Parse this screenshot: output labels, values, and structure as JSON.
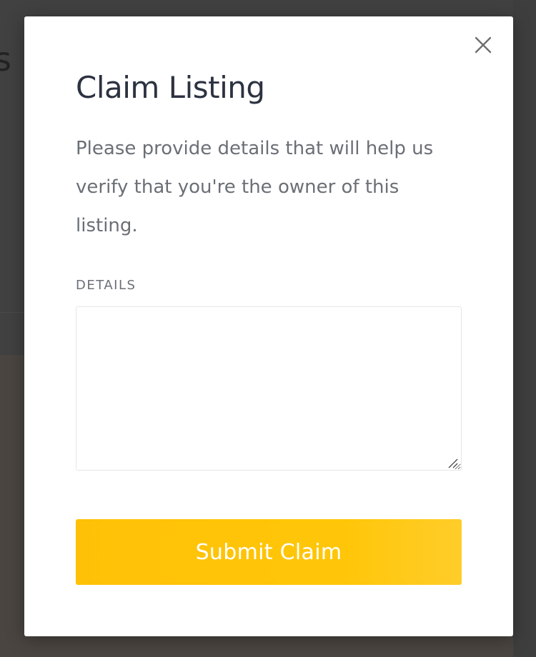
{
  "background": {
    "heading_fragment": "s"
  },
  "modal": {
    "title": "Claim Listing",
    "description": "Please provide details that will help us verify that you're the owner of this listing.",
    "close_icon": "close-icon",
    "details_label": "DETAILS",
    "details_value": "",
    "details_placeholder": "",
    "submit_label": "Submit Claim"
  },
  "colors": {
    "accent": "#ffc107",
    "title": "#2c3240",
    "body_text": "#6b6f76",
    "overlay": "#414141"
  }
}
